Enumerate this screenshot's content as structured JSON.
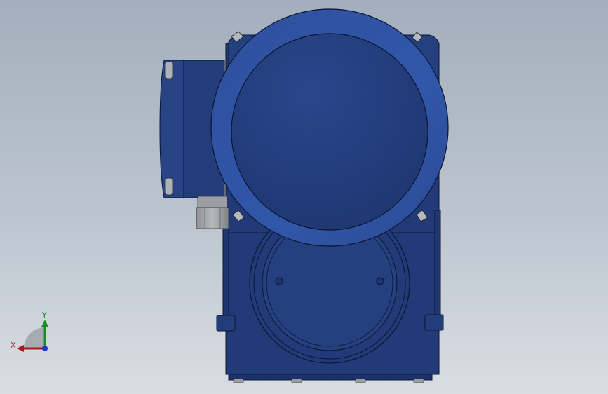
{
  "view": {
    "background_top": "#a3afbd",
    "background_bottom": "#d9dee3",
    "model_color": "#233d7a",
    "model_highlight": "#3558a8",
    "edge_color": "#0b1530",
    "fastener_color": "#b5b8bc"
  },
  "triad": {
    "x_label": "X",
    "y_label": "Y",
    "x_color": "#b0171e",
    "y_color": "#1e8b24",
    "z_color": "#1f3ac7"
  }
}
